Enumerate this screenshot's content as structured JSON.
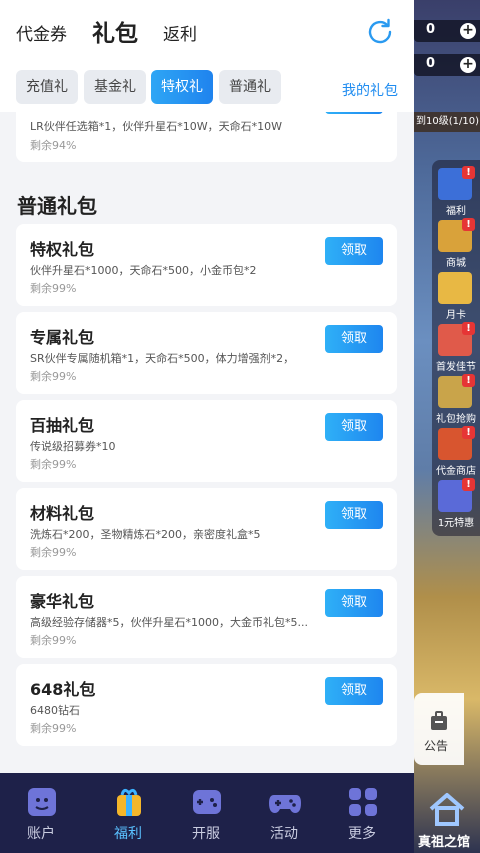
{
  "header": {
    "tabs": [
      "代金券",
      "礼包",
      "返利"
    ]
  },
  "subtabs": [
    "充值礼包",
    "基金礼包",
    "特权礼包",
    "普通礼包"
  ],
  "my_gift_label": "我的礼包",
  "partial_card": {
    "desc": "LR伙伴任选箱*1，伙伴升星石*10W，天命石*10W",
    "remain": "剩余94%"
  },
  "section_title": "普通礼包",
  "claim_label": "领取",
  "packages": [
    {
      "title": "特权礼包",
      "desc": "伙伴升星石*1000，天命石*500，小金币包*2",
      "remain": "剩余99%"
    },
    {
      "title": "专属礼包",
      "desc": "SR伙伴专属随机箱*1，天命石*500，体力增强剂*2，",
      "remain": "剩余99%"
    },
    {
      "title": "百抽礼包",
      "desc": "传说级招募券*10",
      "remain": "剩余99%"
    },
    {
      "title": "材料礼包",
      "desc": "洗炼石*200，圣物精炼石*200，亲密度礼盒*5",
      "remain": "剩余99%"
    },
    {
      "title": "豪华礼包",
      "desc": "高级经验存储器*5，伙伴升星石*1000，大金币礼包*5...",
      "remain": "剩余99%"
    },
    {
      "title": "648礼包",
      "desc": "6480钻石",
      "remain": "剩余99%"
    }
  ],
  "bottom_nav": [
    {
      "label": "账户",
      "icon": "account-icon"
    },
    {
      "label": "福利",
      "icon": "gift-bag-icon",
      "active": true
    },
    {
      "label": "开服",
      "icon": "gamepad-icon"
    },
    {
      "label": "活动",
      "icon": "controller-icon"
    },
    {
      "label": "更多",
      "icon": "grid-icon"
    }
  ],
  "game": {
    "resource_1": "0",
    "resource_2": "0",
    "level_text": "到10级(1/10)",
    "side_items": [
      "福利",
      "商城",
      "月卡",
      "首发佳节",
      "礼包抢购",
      "代金商店",
      "1元特惠"
    ],
    "notice_label": "公告",
    "home_label": "真祖之馆"
  },
  "colors": {
    "accent": "#1f8cf0",
    "nav_bg": "#1e2149",
    "alert": "#e63535"
  }
}
